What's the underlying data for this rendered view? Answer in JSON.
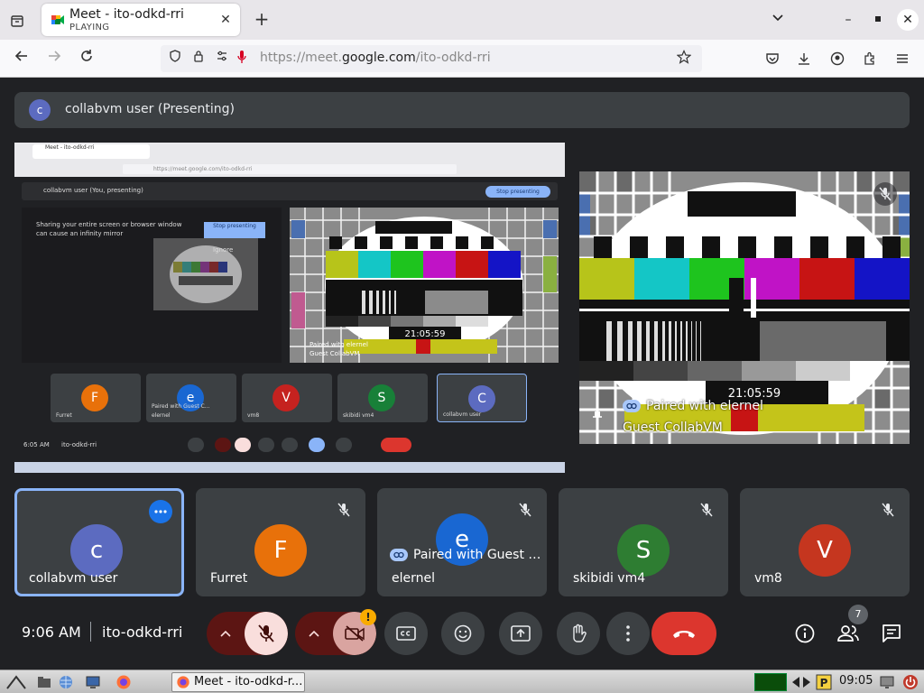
{
  "browser": {
    "tab": {
      "title": "Meet - ito-odkd-rri",
      "status": "PLAYING"
    },
    "url": {
      "prefix": "https://meet.",
      "domain": "google.com",
      "path": "/ito-odkd-rri"
    }
  },
  "meet": {
    "presenting_banner": {
      "avatar_letter": "c",
      "text": "collabvm user (Presenting)"
    },
    "shared_screen": {
      "tab_title": "Meet - ito-odkd-rri",
      "url": "https://meet.google.com/ito-odkd-rri",
      "presenting_text": "collabvm user (You, presenting)",
      "stop_label": "Stop presenting",
      "warning": "Sharing your entire screen or browser window can cause an infinity mirror",
      "stop_label_2": "Stop presenting",
      "ignore_label": "Ignore",
      "tv_time": "21:05:59",
      "tv_pair_text": "Paired with elernel",
      "tv_name": "Guest CollabVM",
      "tiles": [
        {
          "letter": "F",
          "name": "Furret",
          "color": "#e8710a"
        },
        {
          "letter": "e",
          "name": "Paired with Guest C...",
          "sub": "elernel",
          "color": "#1967d2"
        },
        {
          "letter": "V",
          "name": "vm8",
          "color": "#c5221f"
        },
        {
          "letter": "S",
          "name": "skibidi vm4",
          "color": "#188038"
        },
        {
          "letter": "C",
          "name": "collabvm user",
          "color": "#5c6bc0"
        }
      ],
      "time": "6:05 AM",
      "code": "ito-odkd-rri"
    },
    "remote_tile": {
      "tv_time": "21:05:59",
      "pair_text": "Paired with elernel",
      "name": "Guest CollabVM"
    },
    "participants": [
      {
        "letter": "c",
        "name": "collabvm user",
        "color": "#5c6bc0"
      },
      {
        "letter": "F",
        "name": "Furret",
        "color": "#e8710a"
      },
      {
        "letter": "e",
        "name": "elernel",
        "color": "#1967d2",
        "pair": "Paired with Guest CollabVM"
      },
      {
        "letter": "S",
        "name": "skibidi vm4",
        "color": "#2e7d32"
      },
      {
        "letter": "V",
        "name": "vm8",
        "color": "#c5361f"
      }
    ],
    "controls": {
      "time": "9:06 AM",
      "code": "ito-odkd-rri",
      "warn_symbol": "!",
      "people_count": "7"
    }
  },
  "taskbar": {
    "task_title": "Meet - ito-odkd-r...",
    "clock": "09:05"
  },
  "colors": {
    "accent": "#8ab4f8",
    "end_call": "#dc362e",
    "muted_bg": "#f9dedc",
    "muted_dark": "#5c1513"
  }
}
